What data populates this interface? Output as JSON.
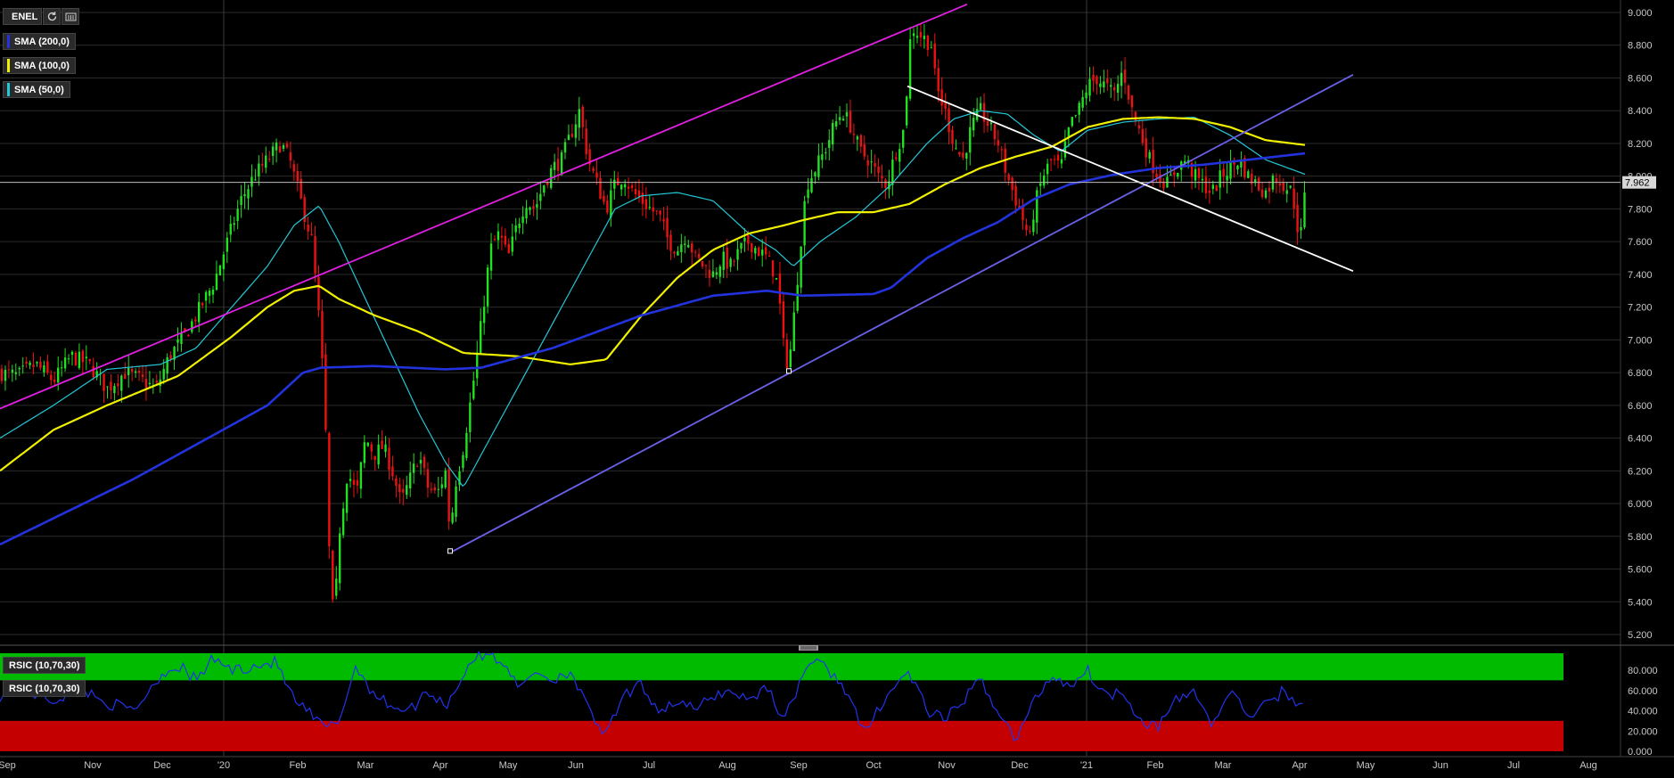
{
  "toolbar": {
    "ticker": "ENEL",
    "refresh_icon": "refresh-icon",
    "settings_icon": "chart-settings-icon"
  },
  "indicators": [
    {
      "label": "SMA (200,0)",
      "color": "#2233dd"
    },
    {
      "label": "SMA (100,0)",
      "color": "#f0f000"
    },
    {
      "label": "SMA (50,0)",
      "color": "#22c8d8"
    }
  ],
  "rsi_labels": [
    "RSIC (10,70,30)",
    "RSIC (10,70,30)"
  ],
  "chart_data": {
    "type": "candlestick",
    "ticker": "ENEL",
    "last_price": "7.962",
    "price_ticks": [
      "9.000",
      "8.800",
      "8.600",
      "8.400",
      "8.200",
      "8.000",
      "7.800",
      "7.600",
      "7.400",
      "7.200",
      "7.000",
      "6.800",
      "6.600",
      "6.400",
      "6.200",
      "6.000",
      "5.800",
      "5.600",
      "5.400",
      "5.200"
    ],
    "ylim": [
      5.1,
      9.05
    ],
    "month_ticks": [
      "Sep",
      "Nov",
      "Dec",
      "'20",
      "Feb",
      "Mar",
      "Apr",
      "May",
      "Jun",
      "Jul",
      "Aug",
      "Sep",
      "Oct",
      "Nov",
      "Dec",
      "'21",
      "Feb",
      "Mar",
      "Apr",
      "May",
      "Jun",
      "Jul",
      "Aug"
    ],
    "close_anchors": [
      [
        0,
        6.8
      ],
      [
        20,
        6.78
      ],
      [
        40,
        6.85
      ],
      [
        60,
        6.75
      ],
      [
        80,
        6.9
      ],
      [
        100,
        6.85
      ],
      [
        120,
        6.7
      ],
      [
        140,
        6.8
      ],
      [
        160,
        6.75
      ],
      [
        175,
        6.7
      ],
      [
        190,
        6.9
      ],
      [
        210,
        7.05
      ],
      [
        225,
        7.2
      ],
      [
        240,
        7.35
      ],
      [
        255,
        7.6
      ],
      [
        270,
        7.85
      ],
      [
        285,
        8.0
      ],
      [
        300,
        8.1
      ],
      [
        315,
        8.2
      ],
      [
        325,
        8.1
      ],
      [
        330,
        8.0
      ],
      [
        340,
        7.8
      ],
      [
        350,
        7.6
      ],
      [
        360,
        7.0
      ],
      [
        365,
        6.5
      ],
      [
        370,
        5.6
      ],
      [
        375,
        5.25
      ],
      [
        380,
        5.8
      ],
      [
        390,
        6.2
      ],
      [
        400,
        6.05
      ],
      [
        410,
        6.4
      ],
      [
        420,
        6.3
      ],
      [
        430,
        6.35
      ],
      [
        440,
        6.2
      ],
      [
        450,
        6.0
      ],
      [
        460,
        6.15
      ],
      [
        470,
        6.3
      ],
      [
        480,
        6.1
      ],
      [
        490,
        6.05
      ],
      [
        500,
        6.2
      ],
      [
        505,
        5.8
      ],
      [
        510,
        6.1
      ],
      [
        520,
        6.35
      ],
      [
        530,
        6.7
      ],
      [
        540,
        7.1
      ],
      [
        550,
        7.55
      ],
      [
        560,
        7.65
      ],
      [
        570,
        7.5
      ],
      [
        580,
        7.7
      ],
      [
        590,
        7.85
      ],
      [
        600,
        7.8
      ],
      [
        610,
        7.95
      ],
      [
        620,
        8.05
      ],
      [
        630,
        8.1
      ],
      [
        640,
        8.25
      ],
      [
        650,
        8.4
      ],
      [
        660,
        8.1
      ],
      [
        670,
        7.95
      ],
      [
        680,
        7.8
      ],
      [
        690,
        7.95
      ],
      [
        700,
        8.0
      ],
      [
        710,
        7.9
      ],
      [
        720,
        7.85
      ],
      [
        730,
        7.8
      ],
      [
        740,
        7.75
      ],
      [
        750,
        7.6
      ],
      [
        760,
        7.55
      ],
      [
        770,
        7.65
      ],
      [
        780,
        7.5
      ],
      [
        790,
        7.45
      ],
      [
        800,
        7.4
      ],
      [
        810,
        7.5
      ],
      [
        820,
        7.45
      ],
      [
        830,
        7.55
      ],
      [
        840,
        7.6
      ],
      [
        850,
        7.55
      ],
      [
        860,
        7.5
      ],
      [
        870,
        7.4
      ],
      [
        875,
        7.2
      ],
      [
        880,
        6.9
      ],
      [
        885,
        6.85
      ],
      [
        890,
        7.1
      ],
      [
        895,
        7.4
      ],
      [
        900,
        7.7
      ],
      [
        905,
        7.95
      ],
      [
        915,
        8.05
      ],
      [
        925,
        8.15
      ],
      [
        935,
        8.3
      ],
      [
        945,
        8.4
      ],
      [
        955,
        8.3
      ],
      [
        965,
        8.15
      ],
      [
        975,
        8.1
      ],
      [
        985,
        8.0
      ],
      [
        995,
        7.95
      ],
      [
        1005,
        8.15
      ],
      [
        1015,
        8.3
      ],
      [
        1020,
        8.8
      ],
      [
        1025,
        8.9
      ],
      [
        1035,
        8.85
      ],
      [
        1045,
        8.8
      ],
      [
        1050,
        8.55
      ],
      [
        1060,
        8.4
      ],
      [
        1070,
        8.2
      ],
      [
        1080,
        8.1
      ],
      [
        1090,
        8.3
      ],
      [
        1100,
        8.4
      ],
      [
        1110,
        8.3
      ],
      [
        1120,
        8.2
      ],
      [
        1130,
        8.0
      ],
      [
        1140,
        7.85
      ],
      [
        1150,
        7.7
      ],
      [
        1155,
        7.6
      ],
      [
        1160,
        7.8
      ],
      [
        1170,
        8.0
      ],
      [
        1180,
        8.1
      ],
      [
        1190,
        8.05
      ],
      [
        1200,
        8.3
      ],
      [
        1210,
        8.4
      ],
      [
        1220,
        8.55
      ],
      [
        1230,
        8.6
      ],
      [
        1240,
        8.55
      ],
      [
        1250,
        8.5
      ],
      [
        1260,
        8.65
      ],
      [
        1270,
        8.4
      ],
      [
        1280,
        8.25
      ],
      [
        1290,
        8.1
      ],
      [
        1300,
        8.0
      ],
      [
        1310,
        7.95
      ],
      [
        1320,
        8.05
      ],
      [
        1330,
        8.1
      ],
      [
        1340,
        8.0
      ],
      [
        1350,
        7.95
      ],
      [
        1360,
        7.9
      ],
      [
        1370,
        8.0
      ],
      [
        1380,
        8.05
      ],
      [
        1390,
        8.1
      ],
      [
        1400,
        8.0
      ],
      [
        1410,
        7.95
      ],
      [
        1420,
        7.9
      ],
      [
        1430,
        8.0
      ],
      [
        1440,
        7.95
      ],
      [
        1450,
        7.9
      ],
      [
        1455,
        7.7
      ],
      [
        1460,
        7.65
      ],
      [
        1465,
        7.962
      ]
    ],
    "sma200_anchors": [
      [
        0,
        5.75
      ],
      [
        150,
        6.15
      ],
      [
        300,
        6.6
      ],
      [
        340,
        6.8
      ],
      [
        360,
        6.83
      ],
      [
        420,
        6.84
      ],
      [
        500,
        6.82
      ],
      [
        540,
        6.83
      ],
      [
        620,
        6.95
      ],
      [
        720,
        7.15
      ],
      [
        800,
        7.27
      ],
      [
        860,
        7.3
      ],
      [
        900,
        7.27
      ],
      [
        980,
        7.28
      ],
      [
        1000,
        7.32
      ],
      [
        1040,
        7.5
      ],
      [
        1080,
        7.62
      ],
      [
        1120,
        7.72
      ],
      [
        1160,
        7.86
      ],
      [
        1200,
        7.95
      ],
      [
        1250,
        8.01
      ],
      [
        1300,
        8.05
      ],
      [
        1350,
        8.07
      ],
      [
        1400,
        8.1
      ],
      [
        1465,
        8.14
      ]
    ],
    "sma100_anchors": [
      [
        0,
        6.2
      ],
      [
        60,
        6.45
      ],
      [
        120,
        6.6
      ],
      [
        200,
        6.78
      ],
      [
        260,
        7.02
      ],
      [
        300,
        7.2
      ],
      [
        330,
        7.3
      ],
      [
        358,
        7.33
      ],
      [
        380,
        7.25
      ],
      [
        420,
        7.15
      ],
      [
        470,
        7.05
      ],
      [
        520,
        6.92
      ],
      [
        580,
        6.9
      ],
      [
        640,
        6.85
      ],
      [
        680,
        6.88
      ],
      [
        720,
        7.15
      ],
      [
        760,
        7.38
      ],
      [
        800,
        7.55
      ],
      [
        840,
        7.65
      ],
      [
        880,
        7.7
      ],
      [
        900,
        7.73
      ],
      [
        940,
        7.78
      ],
      [
        980,
        7.78
      ],
      [
        1020,
        7.83
      ],
      [
        1060,
        7.95
      ],
      [
        1100,
        8.05
      ],
      [
        1140,
        8.12
      ],
      [
        1180,
        8.18
      ],
      [
        1220,
        8.3
      ],
      [
        1260,
        8.35
      ],
      [
        1300,
        8.36
      ],
      [
        1340,
        8.35
      ],
      [
        1380,
        8.3
      ],
      [
        1420,
        8.22
      ],
      [
        1465,
        8.19
      ]
    ],
    "sma50_anchors": [
      [
        0,
        6.4
      ],
      [
        60,
        6.6
      ],
      [
        120,
        6.82
      ],
      [
        180,
        6.85
      ],
      [
        220,
        6.95
      ],
      [
        260,
        7.2
      ],
      [
        300,
        7.45
      ],
      [
        330,
        7.7
      ],
      [
        358,
        7.82
      ],
      [
        380,
        7.6
      ],
      [
        410,
        7.25
      ],
      [
        440,
        6.9
      ],
      [
        470,
        6.55
      ],
      [
        500,
        6.25
      ],
      [
        520,
        6.1
      ],
      [
        550,
        6.4
      ],
      [
        590,
        6.8
      ],
      [
        620,
        7.1
      ],
      [
        660,
        7.5
      ],
      [
        690,
        7.8
      ],
      [
        720,
        7.88
      ],
      [
        760,
        7.9
      ],
      [
        800,
        7.85
      ],
      [
        840,
        7.65
      ],
      [
        870,
        7.55
      ],
      [
        890,
        7.45
      ],
      [
        920,
        7.6
      ],
      [
        960,
        7.75
      ],
      [
        1000,
        7.95
      ],
      [
        1040,
        8.2
      ],
      [
        1070,
        8.35
      ],
      [
        1100,
        8.4
      ],
      [
        1130,
        8.38
      ],
      [
        1160,
        8.25
      ],
      [
        1190,
        8.15
      ],
      [
        1220,
        8.28
      ],
      [
        1260,
        8.33
      ],
      [
        1300,
        8.35
      ],
      [
        1340,
        8.36
      ],
      [
        1380,
        8.25
      ],
      [
        1420,
        8.1
      ],
      [
        1465,
        8.01
      ]
    ],
    "rsi": {
      "ticks": [
        "80.000",
        "60.000",
        "40.000",
        "20.000",
        "0.000"
      ],
      "ylim": [
        0,
        100
      ],
      "overbought": 70,
      "oversold": 30,
      "anchors": [
        [
          0,
          55
        ],
        [
          30,
          60
        ],
        [
          60,
          50
        ],
        [
          90,
          62
        ],
        [
          120,
          48
        ],
        [
          150,
          40
        ],
        [
          180,
          75
        ],
        [
          200,
          85
        ],
        [
          220,
          70
        ],
        [
          240,
          92
        ],
        [
          260,
          80
        ],
        [
          290,
          85
        ],
        [
          310,
          88
        ],
        [
          330,
          50
        ],
        [
          350,
          35
        ],
        [
          365,
          22
        ],
        [
          380,
          30
        ],
        [
          400,
          85
        ],
        [
          420,
          55
        ],
        [
          440,
          45
        ],
        [
          460,
          40
        ],
        [
          480,
          60
        ],
        [
          500,
          45
        ],
        [
          520,
          75
        ],
        [
          530,
          92
        ],
        [
          550,
          95
        ],
        [
          570,
          85
        ],
        [
          580,
          60
        ],
        [
          600,
          80
        ],
        [
          620,
          70
        ],
        [
          640,
          80
        ],
        [
          660,
          40
        ],
        [
          680,
          15
        ],
        [
          700,
          55
        ],
        [
          720,
          65
        ],
        [
          740,
          40
        ],
        [
          760,
          50
        ],
        [
          780,
          40
        ],
        [
          800,
          55
        ],
        [
          820,
          60
        ],
        [
          840,
          50
        ],
        [
          860,
          65
        ],
        [
          880,
          30
        ],
        [
          900,
          75
        ],
        [
          910,
          90
        ],
        [
          930,
          80
        ],
        [
          950,
          60
        ],
        [
          970,
          15
        ],
        [
          990,
          50
        ],
        [
          1010,
          70
        ],
        [
          1020,
          78
        ],
        [
          1040,
          40
        ],
        [
          1060,
          30
        ],
        [
          1080,
          50
        ],
        [
          1100,
          70
        ],
        [
          1120,
          40
        ],
        [
          1140,
          10
        ],
        [
          1160,
          50
        ],
        [
          1180,
          75
        ],
        [
          1200,
          65
        ],
        [
          1220,
          80
        ],
        [
          1240,
          55
        ],
        [
          1260,
          60
        ],
        [
          1280,
          30
        ],
        [
          1300,
          25
        ],
        [
          1320,
          50
        ],
        [
          1340,
          60
        ],
        [
          1360,
          25
        ],
        [
          1380,
          60
        ],
        [
          1400,
          35
        ],
        [
          1420,
          45
        ],
        [
          1440,
          60
        ],
        [
          1455,
          45
        ],
        [
          1465,
          55
        ]
      ]
    },
    "trendlines": [
      {
        "color": "#e020e0",
        "from": [
          0,
          6.58
        ],
        "to": [
          1085,
          9.05
        ]
      },
      {
        "color": "#6a60e8",
        "from": [
          505,
          5.7
        ],
        "to": [
          1518,
          8.62
        ]
      },
      {
        "color": "#ffffff",
        "from": [
          1018,
          8.55
        ],
        "to": [
          1518,
          7.42
        ]
      }
    ],
    "anchor_points": [
      [
        505,
        5.71
      ],
      [
        885,
        6.81
      ]
    ]
  }
}
